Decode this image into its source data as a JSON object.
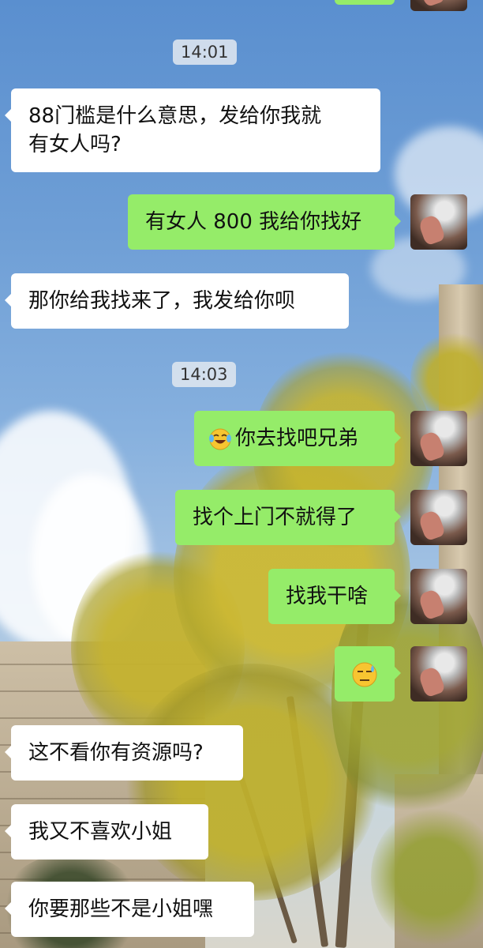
{
  "chat": {
    "timestamps": [
      "14:01",
      "14:03"
    ],
    "messages": [
      {
        "side": "left",
        "lines": [
          "88门槛是什么意思，发给你我就",
          "有女人吗?"
        ]
      },
      {
        "side": "right",
        "text": "有女人 800 我给你找好"
      },
      {
        "side": "left",
        "text": "那你给我找来了，我发给你呗"
      },
      {
        "side": "right",
        "text": "你去找吧兄弟",
        "emoji": "tears-of-joy-emoji"
      },
      {
        "side": "right",
        "text": "找个上门不就得了"
      },
      {
        "side": "right",
        "text": "找我干啥"
      },
      {
        "side": "right",
        "text": "",
        "emoji": "sweat-smile-emoji"
      },
      {
        "side": "left",
        "text": "这不看你有资源吗?"
      },
      {
        "side": "left",
        "text": "我又不喜欢小姐"
      },
      {
        "side": "left",
        "text": "你要那些不是小姐嘿"
      }
    ]
  },
  "colors": {
    "outgoing_bubble": "#95ec69",
    "incoming_bubble": "#ffffff",
    "timestamp_bg": "#dce4ee"
  }
}
